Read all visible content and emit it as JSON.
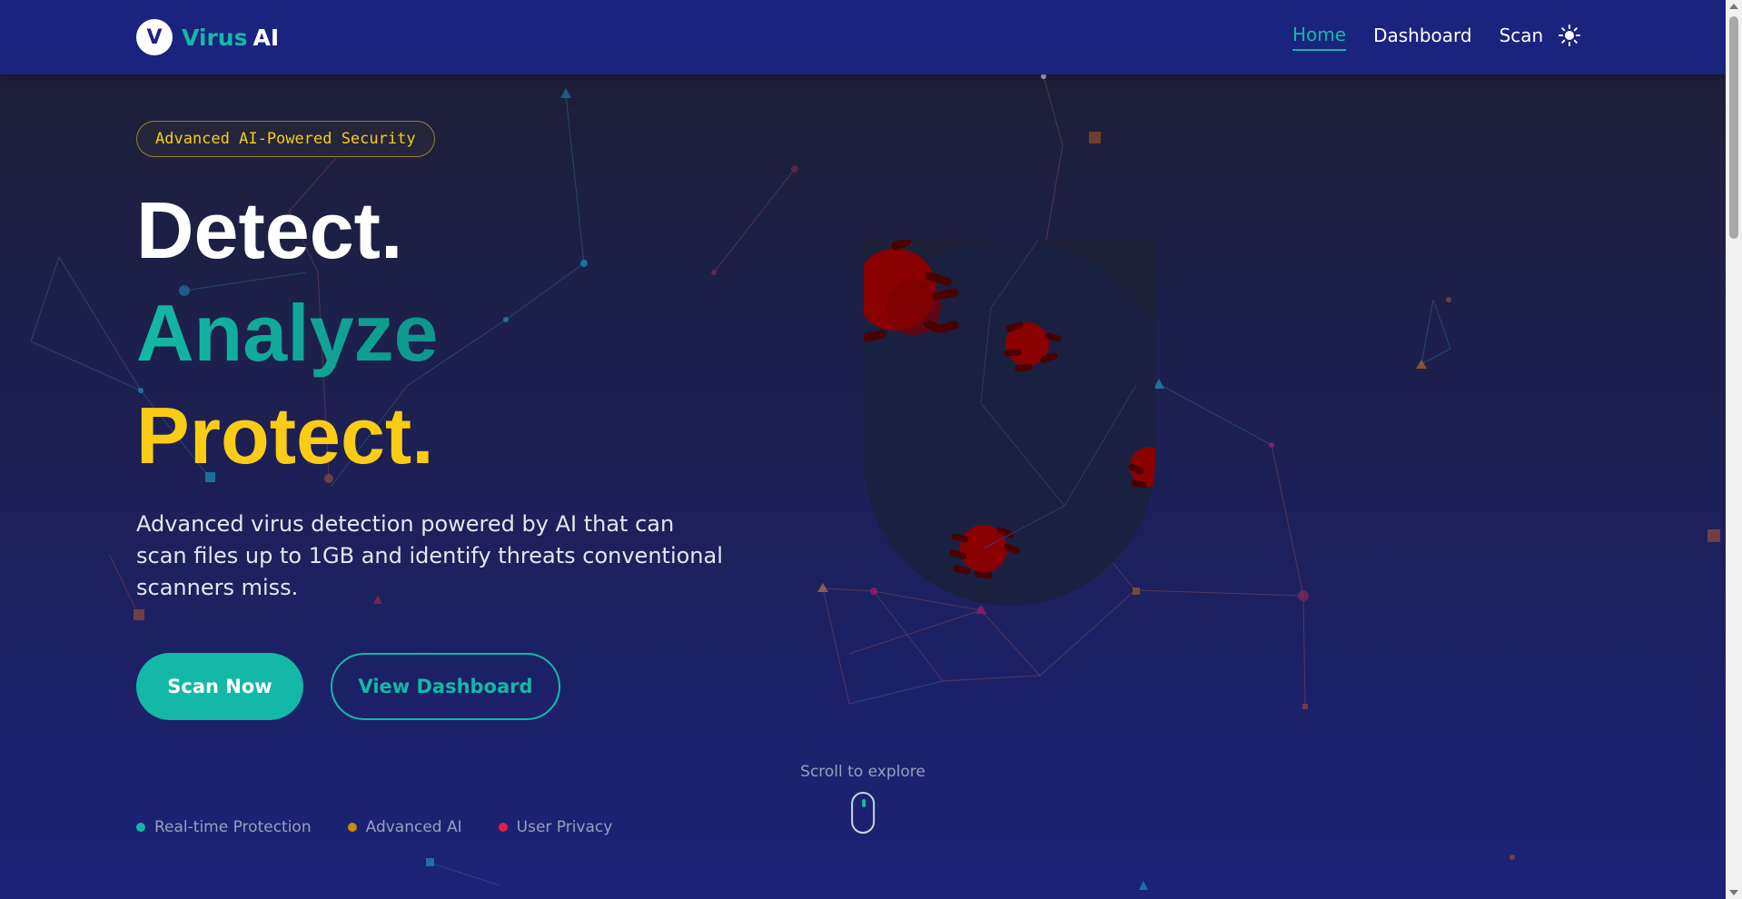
{
  "brand": {
    "logo_letter": "V",
    "name_part1": "Virus",
    "name_part2": "AI"
  },
  "nav": {
    "items": [
      {
        "label": "Home",
        "active": true
      },
      {
        "label": "Dashboard",
        "active": false
      },
      {
        "label": "Scan",
        "active": false
      }
    ],
    "theme_icon": "sun-icon"
  },
  "hero": {
    "badge": "Advanced AI-Powered Security",
    "line1": "Detect.",
    "line2": "Analyze",
    "line3": "Protect.",
    "description": "Advanced virus detection powered by AI that can scan files up to 1GB and identify threats conventional scanners miss.",
    "primary_button": "Scan Now",
    "secondary_button": "View Dashboard"
  },
  "features": [
    {
      "label": "Real-time Protection",
      "color": "#14b8a6"
    },
    {
      "label": "Advanced AI",
      "color": "#ca8a04"
    },
    {
      "label": "User Privacy",
      "color": "#e11d48"
    }
  ],
  "scroll_hint": {
    "text": "Scroll to explore",
    "icon": "mouse-icon"
  },
  "colors": {
    "accent": "#14b8a6",
    "highlight": "#facc15",
    "navbar": "#1a237e",
    "virus": "#8b0000"
  }
}
